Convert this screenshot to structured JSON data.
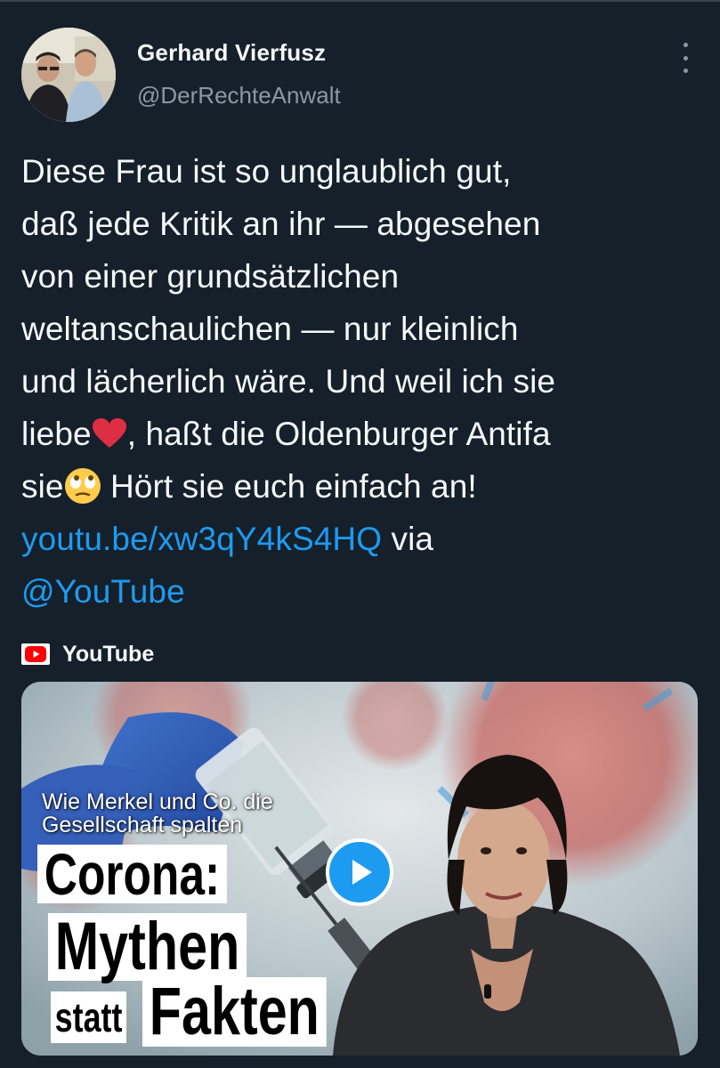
{
  "author": {
    "display_name": "Gerhard Vierfusz",
    "handle": "@DerRechteAnwalt"
  },
  "tweet": {
    "lines": [
      "Diese Frau ist so unglaublich gut,",
      "daß jede Kritik an ihr — abgesehen",
      "von einer grundsätzlichen",
      "weltanschaulichen — nur kleinlich",
      "und lächerlich wäre. Und weil ich sie"
    ],
    "line6_before": "liebe",
    "line6_after": ", haßt die Oldenburger Antifa",
    "line7_before": "sie",
    "line7_after": " Hört sie euch einfach an!",
    "link_url": "youtu.be/xw3qY4kS4HQ",
    "via_text": " via",
    "mention": "@YouTube",
    "emoji_1": "red-heart-emoji",
    "emoji_2": "face-with-rolling-eyes-emoji"
  },
  "card": {
    "source_name": "YouTube",
    "thumbnail_subtitle": "Wie Merkel und Co. die Gesellschaft spalten",
    "thumbnail_title_1": "Corona:",
    "thumbnail_title_2": "Mythen",
    "thumbnail_title_3": "statt",
    "thumbnail_title_4": "Fakten"
  },
  "colors": {
    "background": "#15202b",
    "text": "#f7f9f9",
    "secondary_text": "#8b98a5",
    "link": "#1d9bf0",
    "youtube_red": "#ff0000"
  }
}
